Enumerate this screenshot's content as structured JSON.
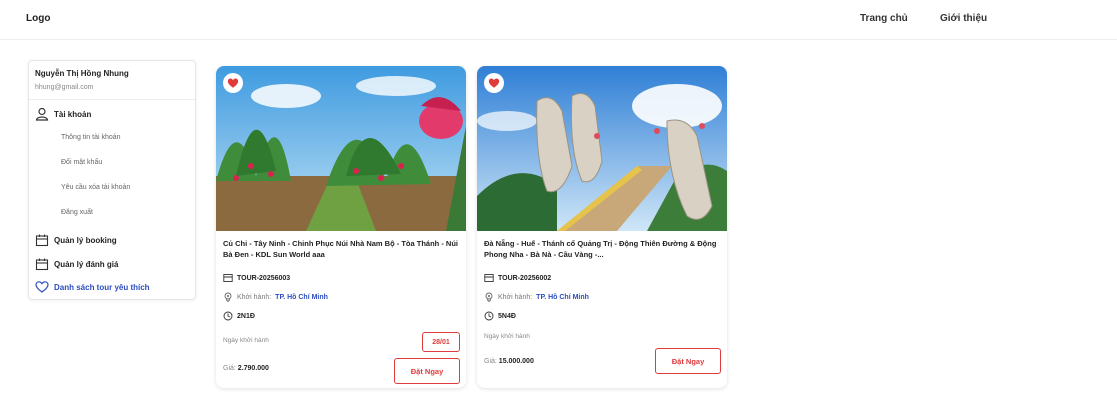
{
  "header": {
    "logo": "Logo",
    "nav": [
      "Trang chủ",
      "Giới thiệu"
    ]
  },
  "sidebar": {
    "user_name": "Nguyễn Thị Hồng Nhung",
    "user_email": "hhung@gmail.com",
    "account_label": "Tài khoản",
    "account_items": [
      "Thông tin tài khoản",
      "Đổi mật khẩu",
      "Yêu cầu xóa tài khoản",
      "Đăng xuất"
    ],
    "booking_label": "Quản lý booking",
    "review_label": "Quản lý đánh giá",
    "favorites_label": "Danh sách tour yêu thích"
  },
  "tours": [
    {
      "title": "Củ Chi - Tây Ninh - Chinh Phục Núi Nhà Nam Bộ - Tòa Thánh - Núi Bà Đen - KDL Sun World aaa",
      "code": "TOUR-20256003",
      "depart_label": "Khởi hành:",
      "depart_city": "TP. Hồ Chí Minh",
      "duration": "2N1Đ",
      "date_label": "Ngày khởi hành",
      "date_badge": "28/01",
      "price_label": "Giá:",
      "price": "2.790.000",
      "book_label": "Đặt Ngay"
    },
    {
      "title": "Đà Nẵng - Huế - Thánh cổ Quảng Trị - Động Thiên Đường & Động Phong Nha - Bà Nà - Cầu Vàng -...",
      "code": "TOUR-20256002",
      "depart_label": "Khởi hành:",
      "depart_city": "TP. Hồ Chí Minh",
      "duration": "5N4Đ",
      "date_label": "Ngày khởi hành",
      "price_label": "Giá:",
      "price": "15.000.000",
      "book_label": "Đặt Ngay"
    }
  ],
  "colors": {
    "accent_red": "#e03b3b",
    "link_blue": "#2b4dbf"
  },
  "icons": {
    "account": "user-icon",
    "booking": "calendar-icon",
    "review": "calendar-icon",
    "favorites": "heart-outline-icon",
    "card_favorite": "heart-icon",
    "code": "ticket-icon",
    "depart": "location-icon",
    "duration": "clock-icon"
  }
}
